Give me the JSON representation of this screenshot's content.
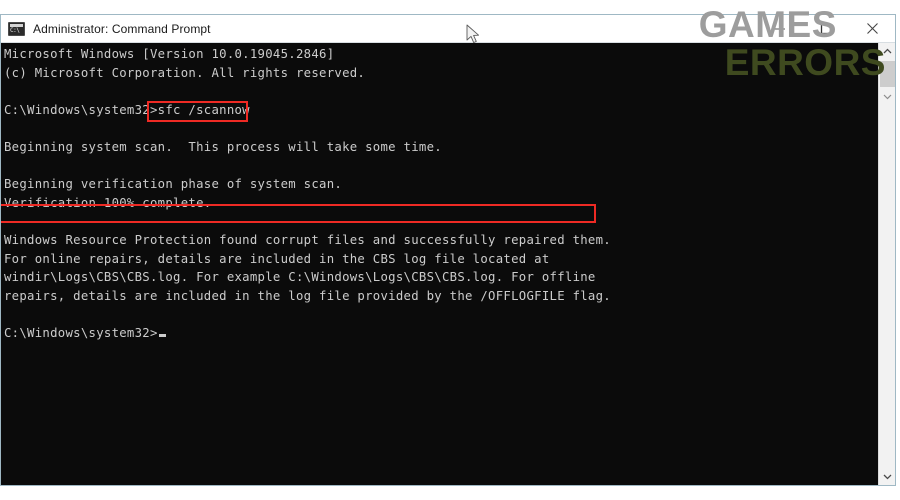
{
  "window": {
    "title": "Administrator: Command Prompt",
    "icon": "cmd-icon",
    "background_color": "#0b0b0b",
    "titlebar_color": "#ffffff"
  },
  "window_buttons": {
    "minimize": {
      "name": "minimize-button",
      "glyph": "minimize-icon"
    },
    "maximize": {
      "name": "maximize-button",
      "glyph": "maximize-icon"
    },
    "close": {
      "name": "close-button",
      "glyph": "close-icon"
    }
  },
  "terminal": {
    "text_color": "#cccccc",
    "prompt_path": "C:\\Windows\\system32>",
    "command": "sfc /scannow",
    "lines": [
      "Microsoft Windows [Version 10.0.19045.2846]",
      "(c) Microsoft Corporation. All rights reserved.",
      "",
      "C:\\Windows\\system32>sfc /scannow",
      "",
      "Beginning system scan.  This process will take some time.",
      "",
      "Beginning verification phase of system scan.",
      "Verification 100% complete.",
      "",
      "Windows Resource Protection found corrupt files and successfully repaired them.",
      "For online repairs, details are included in the CBS log file located at",
      "windir\\Logs\\CBS\\CBS.log. For example C:\\Windows\\Logs\\CBS\\CBS.log. For offline",
      "repairs, details are included in the log file provided by the /OFFLOGFILE flag.",
      "",
      "C:\\Windows\\system32>"
    ],
    "text_block": "Microsoft Windows [Version 10.0.19045.2846]\n(c) Microsoft Corporation. All rights reserved.\n\nC:\\Windows\\system32>sfc /scannow\n\nBeginning system scan.  This process will take some time.\n\nBeginning verification phase of system scan.\nVerification 100% complete.\n\nWindows Resource Protection found corrupt files and successfully repaired them.\nFor online repairs, details are included in the CBS log file located at\nwindir\\Logs\\CBS\\CBS.log. For example C:\\Windows\\Logs\\CBS\\CBS.log. For offline\nrepairs, details are included in the log file provided by the /OFFLOGFILE flag.\n\nC:\\Windows\\system32>"
  },
  "annotations": {
    "color": "#ee2a24",
    "highlight_command": "sfc /scannow",
    "highlight_result": "Windows Resource Protection found corrupt files and successfully repaired them."
  },
  "scrollbar": {
    "up_arrow": "chevron-up-icon",
    "down_arrow": "chevron-down-icon",
    "thumb_color": "#cdcdcd",
    "track_color": "#f2f2f2"
  },
  "watermark": {
    "line1": "GAMES",
    "line2": "ERRORS",
    "line1_color": "#9d9d9d",
    "line2_color": "#3f4a1f"
  }
}
